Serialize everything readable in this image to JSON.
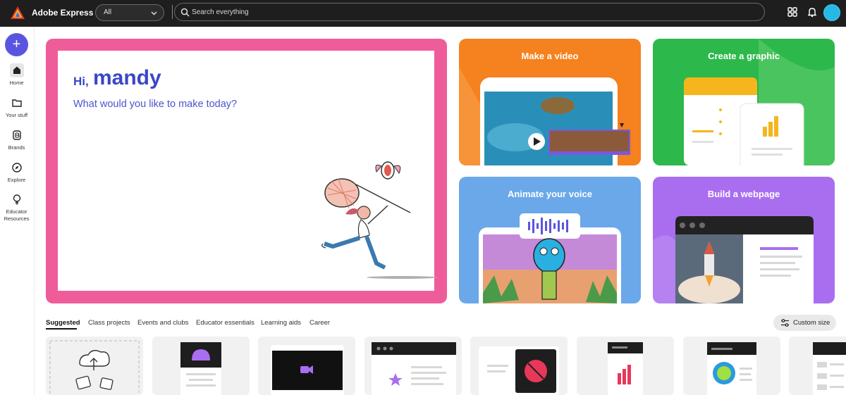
{
  "app": {
    "title": "Adobe Express",
    "scope_select": {
      "selected": "All"
    },
    "search": {
      "placeholder": "Search everything"
    }
  },
  "topbar_icons": [
    "apps-grid-icon",
    "bell-icon"
  ],
  "sidebar": {
    "create_label": "+",
    "items": [
      {
        "label": "Home",
        "icon": "home-icon",
        "active": true
      },
      {
        "label": "Your stuff",
        "icon": "folder-icon",
        "active": false
      },
      {
        "label": "Brands",
        "icon": "brand-icon",
        "active": false
      },
      {
        "label": "Explore",
        "icon": "compass-icon",
        "active": false
      },
      {
        "label": "Educator Resources",
        "icon": "lightbulb-icon",
        "active": false
      }
    ]
  },
  "hero": {
    "greeting": "Hi,",
    "name": "mandy",
    "prompt": "What would you like to make today?"
  },
  "quick_actions": [
    {
      "title": "Make a video",
      "color": "#f5811f"
    },
    {
      "title": "Create a graphic",
      "color": "#2db84b"
    },
    {
      "title": "Animate your voice",
      "color": "#6aa8ea"
    },
    {
      "title": "Build a webpage",
      "color": "#a96ef0"
    }
  ],
  "tabs": [
    {
      "label": "Suggested",
      "active": true
    },
    {
      "label": "Class projects",
      "active": false
    },
    {
      "label": "Events and clubs",
      "active": false
    },
    {
      "label": "Educator essentials",
      "active": false
    },
    {
      "label": "Learning aids",
      "active": false
    },
    {
      "label": "Career",
      "active": false
    }
  ],
  "custom_size": {
    "label": "Custom size"
  },
  "colors": {
    "accent": "#5a55e0",
    "hero_border": "#ef5c9a",
    "greeting_text": "#3a46c8",
    "topbar": "#1e1e1e"
  }
}
